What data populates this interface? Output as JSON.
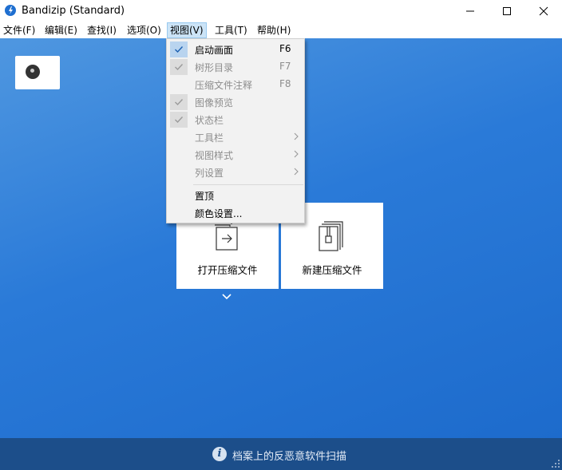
{
  "window": {
    "title": "Bandizip (Standard)",
    "app_icon": "bandizip-logo-icon",
    "controls": [
      "minimize-icon",
      "maximize-icon",
      "close-icon"
    ]
  },
  "menubar": {
    "items": [
      {
        "label": "文件(F)"
      },
      {
        "label": "编辑(E)"
      },
      {
        "label": "查找(I)"
      },
      {
        "label": "选项(O)"
      },
      {
        "label": "视图(V)",
        "active": true
      },
      {
        "label": "工具(T)"
      },
      {
        "label": "帮助(H)"
      }
    ]
  },
  "view_menu": {
    "items": [
      {
        "label": "启动画面",
        "shortcut": "F6",
        "checked": true,
        "enabled": true
      },
      {
        "label": "树形目录",
        "shortcut": "F7",
        "checked": true,
        "enabled": false
      },
      {
        "label": "压缩文件注释",
        "shortcut": "F8",
        "checked": false,
        "enabled": false
      },
      {
        "label": "图像预览",
        "shortcut": "",
        "checked": true,
        "enabled": false
      },
      {
        "label": "状态栏",
        "shortcut": "",
        "checked": true,
        "enabled": false
      },
      {
        "label": "工具栏",
        "submenu": true,
        "enabled": false
      },
      {
        "label": "视图样式",
        "submenu": true,
        "enabled": false
      },
      {
        "label": "列设置",
        "submenu": true,
        "enabled": false
      },
      {
        "label": "置顶",
        "enabled": true
      },
      {
        "label": "颜色设置...",
        "enabled": true
      }
    ]
  },
  "start_screen": {
    "open_archive_label": "打开压缩文件",
    "new_archive_label": "新建压缩文件",
    "open_icon": "open-archive-icon",
    "new_icon": "new-archive-icon",
    "expand_icon": "chevron-down-icon"
  },
  "statusbar": {
    "text": "档案上的反恶意软件扫描",
    "icon": "info-icon"
  },
  "colors": {
    "background_top": "#4f97e0",
    "background_bottom": "#1d6bcc",
    "statusbar": "#1c4e8a",
    "menu_highlight": "#cce4f7"
  }
}
